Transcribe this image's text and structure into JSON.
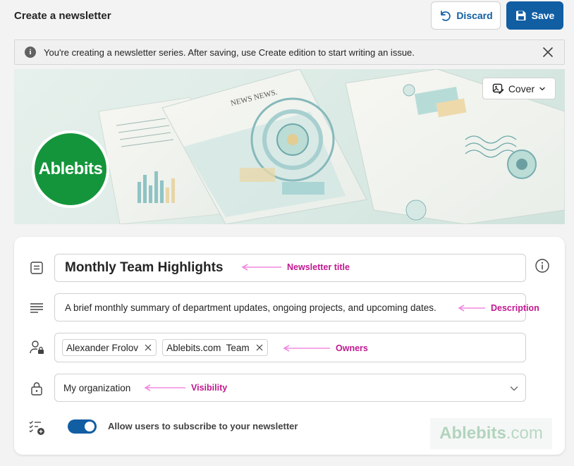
{
  "header": {
    "title": "Create a newsletter",
    "discard_label": "Discard",
    "save_label": "Save"
  },
  "banner": {
    "icon": "info-icon",
    "text": "You're creating a newsletter series. After saving, use Create edition to start writing an issue."
  },
  "cover": {
    "button_label": "Cover",
    "logo_text": "Ablebits",
    "art_headline": "NEWS NEWS."
  },
  "form": {
    "title_value": "Monthly Team Highlights",
    "description_value": "A brief monthly summary of department updates, ongoing projects, and upcoming dates.",
    "owners": [
      {
        "name": "Alexander Frolov"
      },
      {
        "name": "Ablebits.com  Team"
      }
    ],
    "visibility_value": "My organization",
    "subscribe_label": "Allow users to subscribe to your newsletter",
    "subscribe_on": true
  },
  "annotations": {
    "title": "Newsletter title",
    "description": "Description",
    "owners": "Owners",
    "visibility": "Visibility"
  },
  "watermark": {
    "brand": "Ablebits",
    "domain": ".com"
  },
  "colors": {
    "accent": "#115ea3",
    "annotation": "#c0188f",
    "logo_green": "#15953b"
  }
}
